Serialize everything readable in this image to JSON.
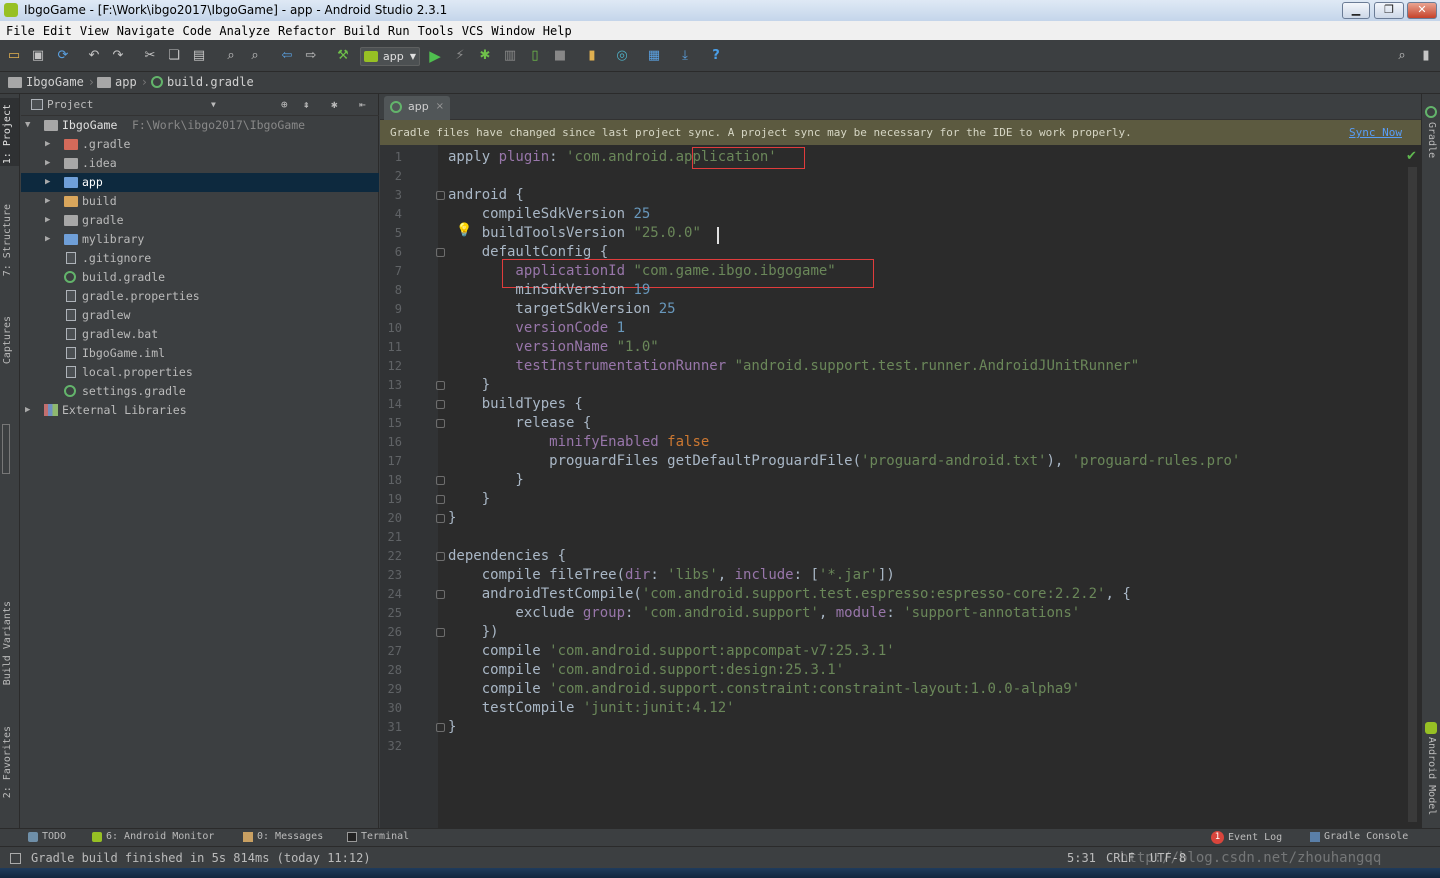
{
  "window": {
    "title": "IbgoGame - [F:\\Work\\ibgo2017\\IbgoGame] - app - Android Studio 2.3.1"
  },
  "menu": [
    "File",
    "Edit",
    "View",
    "Navigate",
    "Code",
    "Analyze",
    "Refactor",
    "Build",
    "Run",
    "Tools",
    "VCS",
    "Window",
    "Help"
  ],
  "toolbar": {
    "run_config": "app"
  },
  "breadcrumb": [
    "IbgoGame",
    "app",
    "build.gradle"
  ],
  "left_tabs": [
    "1: Project",
    "7: Structure",
    "Captures",
    "Build Variants",
    "2: Favorites"
  ],
  "right_tabs": [
    "Gradle",
    "Android Model"
  ],
  "project_panel": {
    "title": "Project",
    "root": {
      "name": "IbgoGame",
      "path": "F:\\Work\\ibgo2017\\IbgoGame"
    },
    "items": [
      ".gradle",
      ".idea",
      "app",
      "build",
      "gradle",
      "mylibrary",
      ".gitignore",
      "build.gradle",
      "gradle.properties",
      "gradlew",
      "gradlew.bat",
      "IbgoGame.iml",
      "local.properties",
      "settings.gradle",
      "External Libraries"
    ]
  },
  "editor": {
    "tab": "app",
    "notice": "Gradle files have changed since last project sync. A project sync may be necessary for the IDE to work properly.",
    "sync_link": "Sync Now",
    "lines": [
      [
        {
          "t": "apply ",
          "c": ""
        },
        {
          "t": "plugin",
          "c": "p"
        },
        {
          "t": ": ",
          "c": ""
        },
        {
          "t": "'com.android.application'",
          "c": "s"
        }
      ],
      [],
      [
        {
          "t": "android {",
          "c": ""
        }
      ],
      [
        {
          "t": "    compileSdkVersion ",
          "c": ""
        },
        {
          "t": "25",
          "c": "n"
        }
      ],
      [
        {
          "t": "    buildToolsVersion ",
          "c": ""
        },
        {
          "t": "\"25.0.0\"",
          "c": "s"
        }
      ],
      [
        {
          "t": "    defaultConfig {",
          "c": ""
        }
      ],
      [
        {
          "t": "        applicationId ",
          "c": "p"
        },
        {
          "t": "\"com.game.ibgo.ibgogame\"",
          "c": "s"
        }
      ],
      [
        {
          "t": "        minSdkVersion ",
          "c": ""
        },
        {
          "t": "19",
          "c": "n"
        }
      ],
      [
        {
          "t": "        targetSdkVersion ",
          "c": ""
        },
        {
          "t": "25",
          "c": "n"
        }
      ],
      [
        {
          "t": "        versionCode ",
          "c": "p"
        },
        {
          "t": "1",
          "c": "n"
        }
      ],
      [
        {
          "t": "        versionName ",
          "c": "p"
        },
        {
          "t": "\"1.0\"",
          "c": "s"
        }
      ],
      [
        {
          "t": "        testInstrumentationRunner ",
          "c": "p"
        },
        {
          "t": "\"android.support.test.runner.AndroidJUnitRunner\"",
          "c": "s"
        }
      ],
      [
        {
          "t": "    }",
          "c": ""
        }
      ],
      [
        {
          "t": "    buildTypes {",
          "c": ""
        }
      ],
      [
        {
          "t": "        release {",
          "c": ""
        }
      ],
      [
        {
          "t": "            minifyEnabled ",
          "c": "p"
        },
        {
          "t": "false",
          "c": "k"
        }
      ],
      [
        {
          "t": "            proguardFiles getDefaultProguardFile(",
          "c": ""
        },
        {
          "t": "'proguard-android.txt'",
          "c": "s"
        },
        {
          "t": "), ",
          "c": ""
        },
        {
          "t": "'proguard-rules.pro'",
          "c": "s"
        }
      ],
      [
        {
          "t": "        }",
          "c": ""
        }
      ],
      [
        {
          "t": "    }",
          "c": ""
        }
      ],
      [
        {
          "t": "}",
          "c": ""
        }
      ],
      [],
      [
        {
          "t": "dependencies {",
          "c": ""
        }
      ],
      [
        {
          "t": "    compile fileTree(",
          "c": ""
        },
        {
          "t": "dir",
          "c": "p"
        },
        {
          "t": ": ",
          "c": ""
        },
        {
          "t": "'libs'",
          "c": "s"
        },
        {
          "t": ", ",
          "c": ""
        },
        {
          "t": "include",
          "c": "p"
        },
        {
          "t": ": [",
          "c": ""
        },
        {
          "t": "'*.jar'",
          "c": "s"
        },
        {
          "t": "])",
          "c": ""
        }
      ],
      [
        {
          "t": "    androidTestCompile(",
          "c": ""
        },
        {
          "t": "'com.android.support.test.espresso:espresso-core:2.2.2'",
          "c": "s"
        },
        {
          "t": ", {",
          "c": ""
        }
      ],
      [
        {
          "t": "        exclude ",
          "c": ""
        },
        {
          "t": "group",
          "c": "p"
        },
        {
          "t": ": ",
          "c": ""
        },
        {
          "t": "'com.android.support'",
          "c": "s"
        },
        {
          "t": ", ",
          "c": ""
        },
        {
          "t": "module",
          "c": "p"
        },
        {
          "t": ": ",
          "c": ""
        },
        {
          "t": "'support-annotations'",
          "c": "s"
        }
      ],
      [
        {
          "t": "    })",
          "c": ""
        }
      ],
      [
        {
          "t": "    compile ",
          "c": ""
        },
        {
          "t": "'com.android.support:appcompat-v7:25.3.1'",
          "c": "s"
        }
      ],
      [
        {
          "t": "    compile ",
          "c": ""
        },
        {
          "t": "'com.android.support:design:25.3.1'",
          "c": "s"
        }
      ],
      [
        {
          "t": "    compile ",
          "c": ""
        },
        {
          "t": "'com.android.support.constraint:constraint-layout:1.0.0-alpha9'",
          "c": "s"
        }
      ],
      [
        {
          "t": "    testCompile ",
          "c": ""
        },
        {
          "t": "'junit:junit:4.12'",
          "c": "s"
        }
      ],
      [
        {
          "t": "}",
          "c": ""
        }
      ],
      []
    ]
  },
  "bottom_tabs": [
    "TODO",
    "6: Android Monitor",
    "0: Messages",
    "Terminal",
    "Event Log",
    "Gradle Console"
  ],
  "event_log_badge": "1",
  "status": {
    "message": "Gradle build finished in 5s 814ms (today 11:12)",
    "position": "5:31",
    "line_sep": "CRLF",
    "encoding": "UTF-8",
    "watermark": "http://blog.csdn.net/zhouhangqq"
  },
  "colors": {
    "keyword": "#cc7832",
    "string": "#6a8759",
    "number": "#6897bb",
    "property": "#9876aa",
    "text": "#a9b7c6",
    "background": "#2b2b2b",
    "notice": "#5c5a40",
    "selection": "#0d293e"
  }
}
